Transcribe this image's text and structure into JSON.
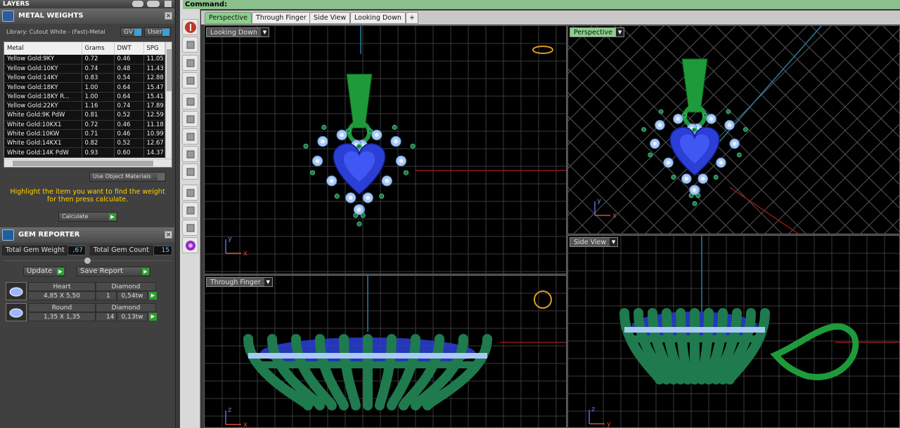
{
  "command_bar": {
    "label": "Command:"
  },
  "tabs": [
    {
      "label": "Perspective",
      "active": true
    },
    {
      "label": "Through Finger",
      "active": false
    },
    {
      "label": "Side View",
      "active": false
    },
    {
      "label": "Looking Down",
      "active": false
    }
  ],
  "tab_add_label": "+",
  "layers_panel": {
    "title": "LAYERS"
  },
  "metal_weights": {
    "title": "METAL WEIGHTS",
    "library": "Library: Cutout White - (Fast)-Metal",
    "toggles": [
      {
        "label": "GV"
      },
      {
        "label": "User"
      }
    ],
    "columns": [
      "Metal",
      "Grams",
      "DWT",
      "SPG"
    ],
    "rows": [
      [
        "Yellow Gold:9KY",
        "0.72",
        "0.46",
        "11.05"
      ],
      [
        "Yellow Gold:10KY",
        "0.74",
        "0.48",
        "11.43"
      ],
      [
        "Yellow Gold:14KY",
        "0.83",
        "0.54",
        "12.88"
      ],
      [
        "Yellow Gold:18KY",
        "1.00",
        "0.64",
        "15.47"
      ],
      [
        "Yellow Gold:18KY R...",
        "1.00",
        "0.64",
        "15.41"
      ],
      [
        "Yellow Gold:22KY",
        "1.16",
        "0.74",
        "17.89"
      ],
      [
        "White Gold:9K PdW",
        "0.81",
        "0.52",
        "12.59"
      ],
      [
        "White Gold:10KX1",
        "0.72",
        "0.46",
        "11.18"
      ],
      [
        "White Gold:10KW",
        "0.71",
        "0.46",
        "10.99"
      ],
      [
        "White Gold:14KX1",
        "0.82",
        "0.52",
        "12.67"
      ],
      [
        "White Gold:14K PdW",
        "0.93",
        "0.60",
        "14.37"
      ]
    ],
    "use_object_materials": "Use Object Materials",
    "hint": "Highlight the item you want to find the weight for then press calculate.",
    "calculate": "Calculate"
  },
  "gem_reporter": {
    "title": "GEM REPORTER",
    "total_weight_label": "Total Gem Weight",
    "total_weight_value": ",67",
    "total_count_label": "Total Gem Count",
    "total_count_value": "15",
    "update": "Update",
    "save_report": "Save Report",
    "gems": [
      {
        "shape": "Heart",
        "type": "Diamond",
        "size": "4,85 X 5,50",
        "qty": "1",
        "weight": "0,54tw"
      },
      {
        "shape": "Round",
        "type": "Diamond",
        "size": "1,35 X 1,35",
        "qty": "14",
        "weight": "0,13tw"
      }
    ]
  },
  "viewports": [
    {
      "label": "Looking Down"
    },
    {
      "label": "Perspective"
    },
    {
      "label": "Through Finger"
    },
    {
      "label": "Side View"
    }
  ],
  "axis_labels": {
    "x": "x",
    "y": "y",
    "z": "z"
  },
  "colors": {
    "accent_green": "#8bd08b",
    "metal": "#1f7a4e",
    "gem_blue": "#2b3fd6",
    "diamond": "#a9c9f5",
    "command_bar": "#8bbf8b"
  }
}
